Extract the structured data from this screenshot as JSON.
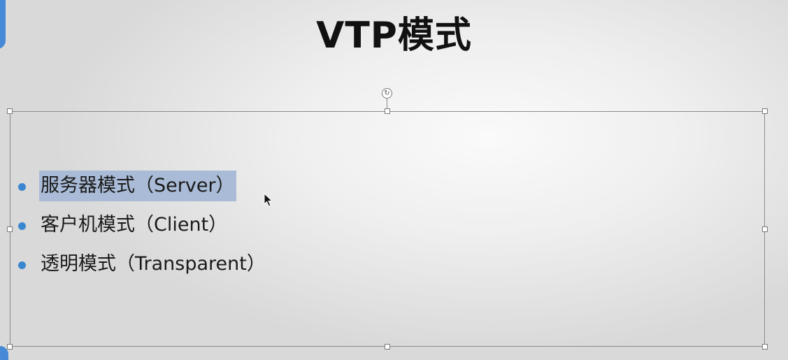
{
  "slide": {
    "title": "VTP模式",
    "bullets": [
      {
        "text": "服务器模式（Server）",
        "selected": true
      },
      {
        "text": "客户机模式（Client）",
        "selected": false
      },
      {
        "text": "透明模式（Transparent）",
        "selected": false
      }
    ]
  },
  "colors": {
    "bullet": "#3a86d1",
    "selection": "#a9bbd6",
    "accent": "#2c7bd6"
  },
  "icons": {
    "rotate": "rotate-icon",
    "cursor": "mouse-pointer-icon"
  }
}
